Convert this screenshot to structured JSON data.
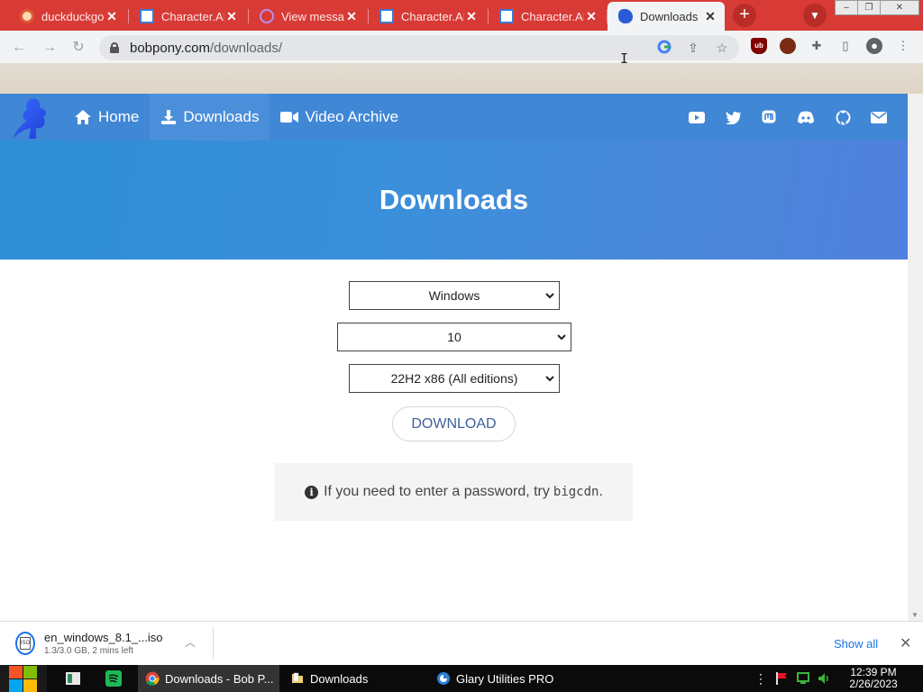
{
  "browser": {
    "tabs": [
      {
        "title": "duckduckgo",
        "favicon": "duckduckgo-icon",
        "active": false
      },
      {
        "title": "Character.AI",
        "favicon": "character-ai-icon",
        "active": false
      },
      {
        "title": "View messages",
        "favicon": "mastodon-view-icon",
        "active": false
      },
      {
        "title": "Character.AI",
        "favicon": "character-ai-icon",
        "active": false
      },
      {
        "title": "Character.AI",
        "favicon": "character-ai-icon",
        "active": false
      },
      {
        "title": "Downloads",
        "favicon": "bobpony-icon",
        "active": true
      }
    ],
    "url_host": "bobpony.com",
    "url_path": "/downloads/",
    "tabstrip_color": "#d83a36"
  },
  "site": {
    "nav": [
      {
        "label": "Home",
        "icon": "home-icon"
      },
      {
        "label": "Downloads",
        "icon": "download-icon"
      },
      {
        "label": "Video Archive",
        "icon": "video-camera-icon"
      }
    ],
    "social_icons": [
      "youtube-icon",
      "twitter-icon",
      "mastodon-icon",
      "discord-icon",
      "github-icon",
      "email-icon"
    ],
    "brand_color": "#4087d6",
    "page_title": "Downloads",
    "selects": {
      "os": "Windows",
      "version": "10",
      "build": "22H2 x86 (All editions)"
    },
    "download_label": "DOWNLOAD",
    "info_text": "If you need to enter a password, try",
    "info_code": "bigcdn",
    "info_tail": "."
  },
  "download_shelf": {
    "file_name": "en_windows_8.1_...iso",
    "status": "1.3/3.0 GB, 2 mins left",
    "show_all": "Show all"
  },
  "taskbar": {
    "tasks": [
      {
        "label": "Downloads - Bob P...",
        "icon": "chrome-icon",
        "active": true
      },
      {
        "label": "Downloads",
        "icon": "folder-icon",
        "active": false
      },
      {
        "label": "Glary Utilities PRO",
        "icon": "glary-icon",
        "active": false
      }
    ],
    "time": "12:39 PM",
    "date": "2/26/2023"
  }
}
